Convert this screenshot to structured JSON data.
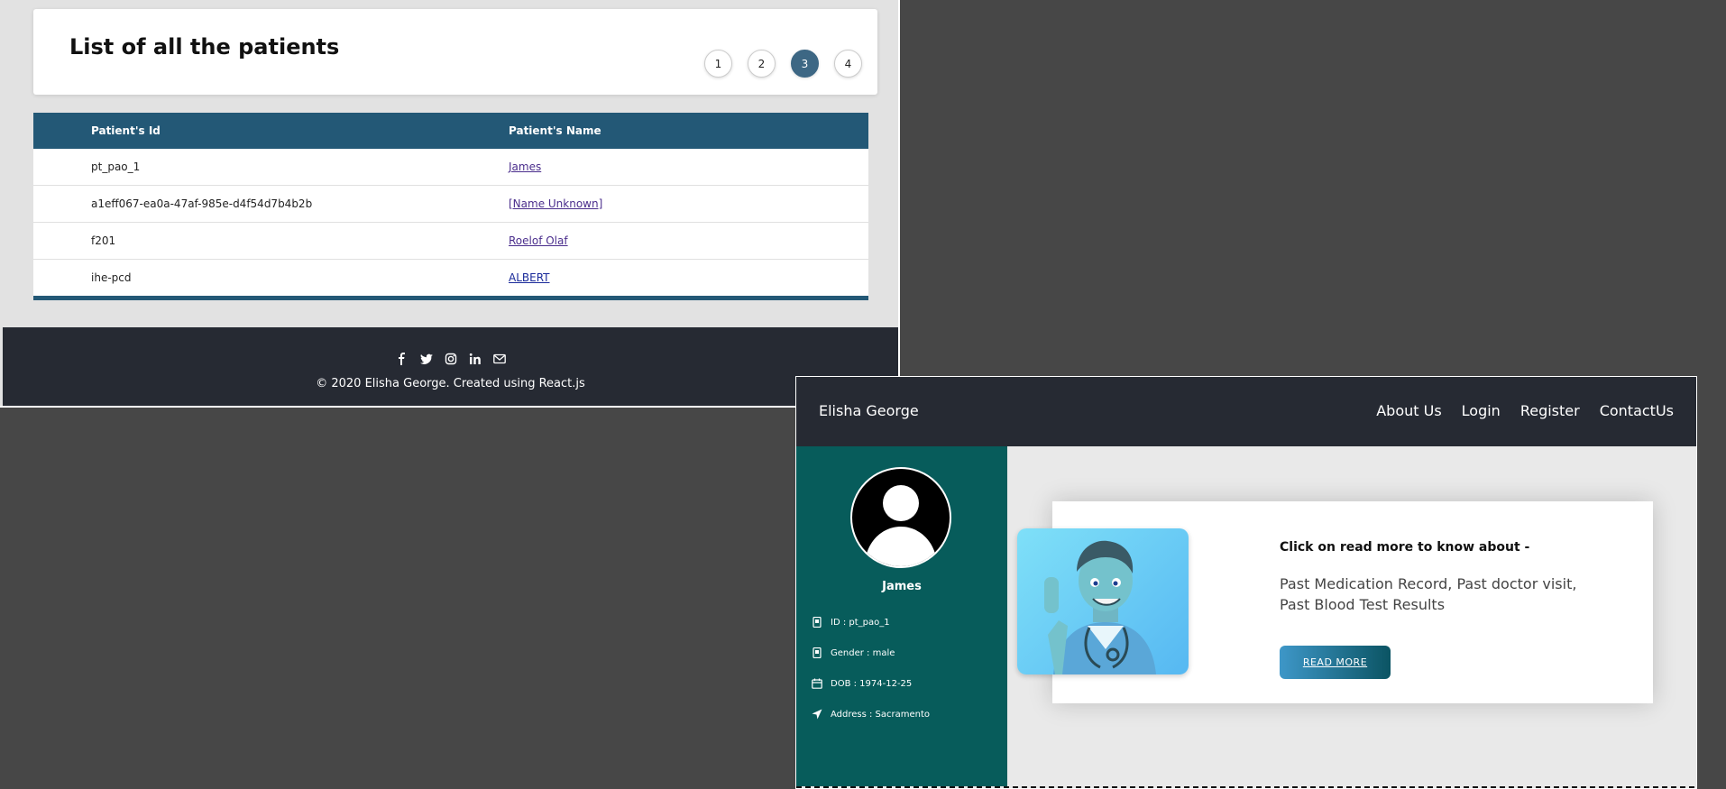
{
  "patient_list": {
    "title": "List of all the patients",
    "pages": [
      "1",
      "2",
      "3",
      "4"
    ],
    "active_page": "3",
    "columns": [
      "Patient's Id",
      "Patient's Name"
    ],
    "rows": [
      {
        "id": "pt_pao_1",
        "name": "James"
      },
      {
        "id": "a1eff067-ea0a-47af-985e-d4f54d7b4b2b",
        "name": "[Name Unknown]"
      },
      {
        "id": "f201",
        "name": "Roelof Olaf"
      },
      {
        "id": "ihe-pcd",
        "name": "ALBERT"
      }
    ],
    "footer": {
      "social_icons": [
        "facebook-icon",
        "twitter-icon",
        "instagram-icon",
        "linkedin-icon",
        "mail-icon"
      ],
      "copyright": "© 2020 Elisha George. Created using React.js"
    }
  },
  "profile": {
    "navbar": {
      "brand": "Elisha George",
      "links": [
        "About Us",
        "Login",
        "Register",
        "ContactUs"
      ]
    },
    "sidebar": {
      "name": "James",
      "id": "ID : pt_pao_1",
      "gender": "Gender : male",
      "dob": "DOB : 1974-12-25",
      "address": "Address : Sacramento"
    },
    "card": {
      "heading": "Click on read more to know about -",
      "text": "Past Medication Record, Past doctor visit, Past Blood Test Results",
      "button": "READ MORE"
    }
  },
  "colors": {
    "desktop": "#474747",
    "table_header": "#235876",
    "active_page": "#3d6784",
    "footer": "#262a33",
    "sidebar": "#075c5b"
  }
}
